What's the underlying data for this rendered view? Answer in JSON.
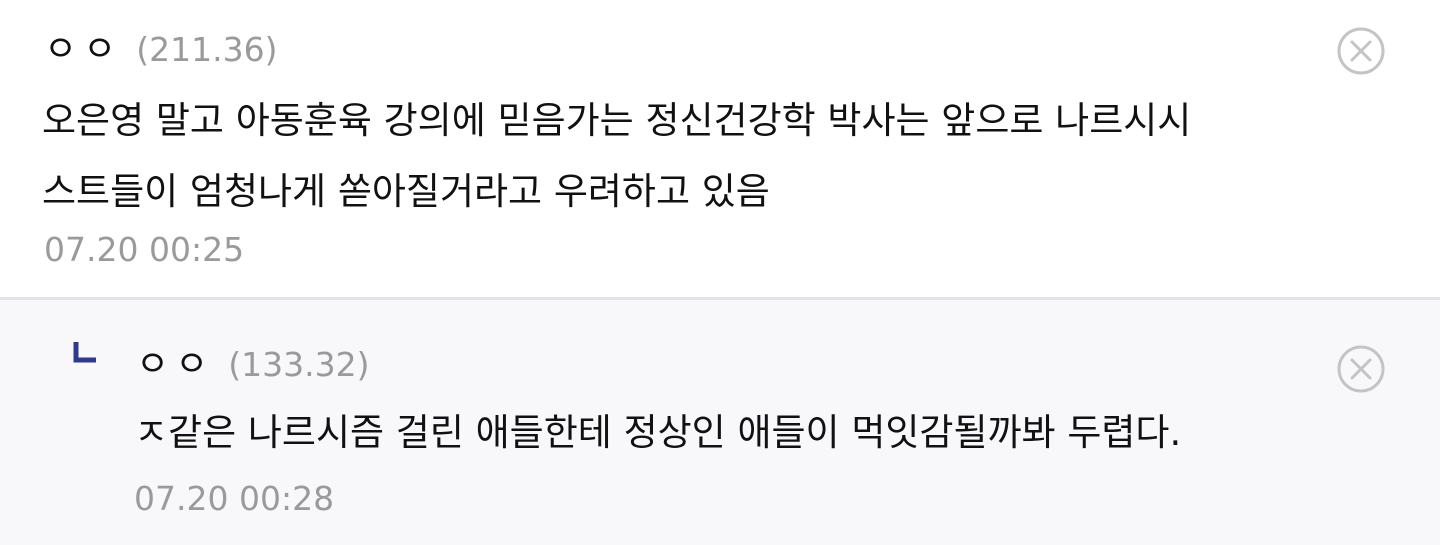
{
  "comments": [
    {
      "nick": "ㅇㅇ",
      "ip": "(211.36)",
      "lines": [
        "오은영 말고 아동훈육 강의에 믿음가는 정신건강학 박사는 앞으로 나르시시",
        "스트들이 엄청나게 쏟아질거라고 우려하고 있음"
      ],
      "time": "07.20 00:25"
    },
    {
      "nick": "ㅇㅇ",
      "ip": "(133.32)",
      "lines": [
        "ㅈ같은 나르시즘 걸린 애들한테 정상인 애들이 먹잇감될까봐 두렵다."
      ],
      "time": "07.20 00:28"
    }
  ],
  "colors": {
    "reply_background": "#f8f8fb",
    "divider": "#e3e3ea",
    "reply_mark": "#2e3a8c",
    "muted_text": "#9a9a9a",
    "close_icon": "#c4c4c4"
  },
  "icons": {
    "delete": "circle-x-icon",
    "reply": "reply-corner-icon"
  }
}
